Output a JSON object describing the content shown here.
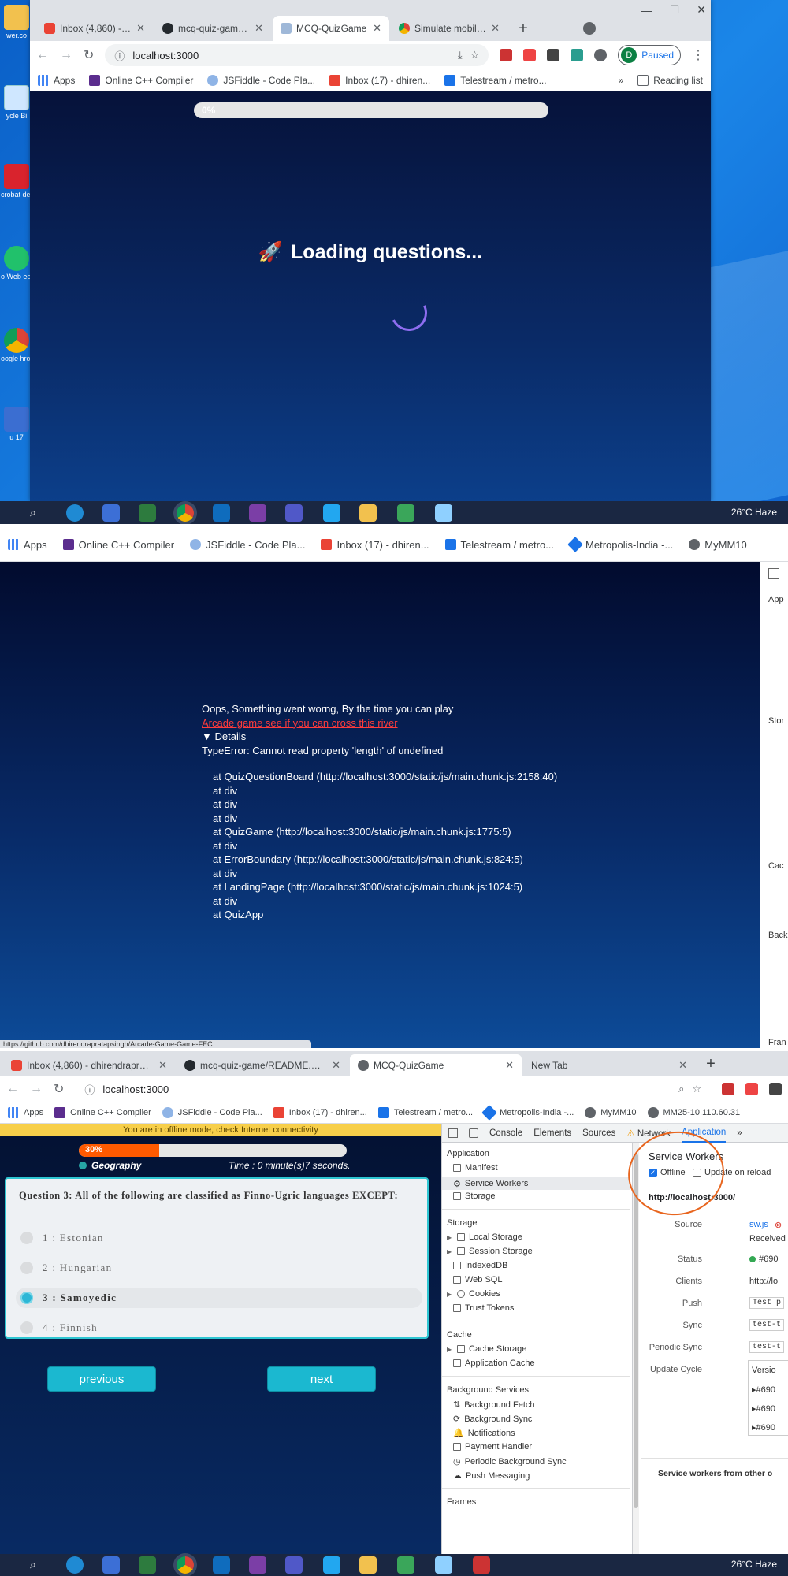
{
  "panel1": {
    "tabs": [
      {
        "title": "Inbox (4,860) - dhir"
      },
      {
        "title": "mcq-quiz-game/RE"
      },
      {
        "title": "MCQ-QuizGame"
      },
      {
        "title": "Simulate mobile d"
      }
    ],
    "address": "localhost:3000",
    "profile_status": "Paused",
    "profile_initial": "D",
    "bookmarks": [
      "Apps",
      "Online C++ Compiler",
      "JSFiddle - Code Pla...",
      "Inbox (17) - dhiren...",
      "Telestream / metro..."
    ],
    "more_bookmarks": "»",
    "reading_list": "Reading list",
    "progress_label": "0%",
    "loading_text": "Loading questions...",
    "desktop_icons": [
      "wer.co",
      "ycle Bi",
      "crobat\nder DC",
      "o Web\neetings",
      "oogle\nhrome",
      "u 17"
    ],
    "weather": "26°C  Haze"
  },
  "panel2": {
    "bookmarks": [
      "Apps",
      "Online C++ Compiler",
      "JSFiddle - Code Pla...",
      "Inbox (17) - dhiren...",
      "Telestream / metro...",
      "Metropolis-India -...",
      "MyMM10"
    ],
    "error_heading": "Oops, Something went worng, By the time you can play",
    "error_link": "Arcade game see if you can cross this river",
    "details_label": "▼ Details",
    "error_message": "TypeError: Cannot read property 'length' of undefined",
    "stack": [
      "at QuizQuestionBoard (http://localhost:3000/static/js/main.chunk.js:2158:40)",
      "at div",
      "at div",
      "at div",
      "at QuizGame (http://localhost:3000/static/js/main.chunk.js:1775:5)",
      "at div",
      "at ErrorBoundary (http://localhost:3000/static/js/main.chunk.js:824:5)",
      "at div",
      "at LandingPage (http://localhost:3000/static/js/main.chunk.js:1024:5)",
      "at div",
      "at QuizApp"
    ],
    "devtools_edge": [
      "App",
      "Stor",
      "Cac",
      "Back",
      "Fran"
    ],
    "status_url": "https://github.com/dhirendrapratapsingh/Arcade-Game-Game-FEC..."
  },
  "panel3": {
    "tabs": [
      {
        "title": "Inbox (4,860) - dhirendrapratapsi"
      },
      {
        "title": "mcq-quiz-game/README.md at"
      },
      {
        "title": "MCQ-QuizGame"
      },
      {
        "title": "New Tab"
      }
    ],
    "address": "localhost:3000",
    "bookmarks": [
      "Apps",
      "Online C++ Compiler",
      "JSFiddle - Code Pla...",
      "Inbox (17) - dhiren...",
      "Telestream / metro...",
      "Metropolis-India -...",
      "MyMM10",
      "MM25-10.110.60.31"
    ],
    "offline_notice": "You are in offline mode, check Internet connectivity",
    "progress_label": "30%",
    "progress_value": 0.3,
    "category": "Geography",
    "timer": "Time :  0 minute(s)7 seconds.",
    "question": "Question 3: All of the following are classified as Finno-Ugric languages EXCEPT:",
    "options": [
      "1 : Estonian",
      "2 : Hungarian",
      "3 : Samoyedic",
      "4 : Finnish"
    ],
    "selected_option": 2,
    "prev_label": "previous",
    "next_label": "next",
    "devtools": {
      "tabs": [
        "Console",
        "Elements",
        "Sources",
        "Network",
        "Application",
        "»"
      ],
      "sections": {
        "application": "Application",
        "app_items": [
          "Manifest",
          "Service Workers",
          "Storage"
        ],
        "storage": "Storage",
        "storage_items": [
          "Local Storage",
          "Session Storage",
          "IndexedDB",
          "Web SQL",
          "Cookies",
          "Trust Tokens"
        ],
        "cache": "Cache",
        "cache_items": [
          "Cache Storage",
          "Application Cache"
        ],
        "background": "Background Services",
        "background_items": [
          "Background Fetch",
          "Background Sync",
          "Notifications",
          "Payment Handler",
          "Periodic Background Sync",
          "Push Messaging"
        ],
        "frames": "Frames"
      },
      "main": {
        "title": "Service Workers",
        "offline_label": "Offline",
        "update_label": "Update on reload",
        "origin": "http://localhost:3000/",
        "source_label": "Source",
        "source_value": "sw.js",
        "received": "Received",
        "status_label": "Status",
        "status_value": "#690",
        "clients_label": "Clients",
        "clients_value": "http://lo",
        "push_label": "Push",
        "push_value": "Test p",
        "sync_label": "Sync",
        "sync_value": "test-t",
        "periodic_label": "Periodic Sync",
        "periodic_value": "test-t",
        "update_cycle_label": "Update Cycle",
        "version_label": "Versio",
        "versions": [
          "▸#690",
          "▸#690",
          "▸#690"
        ],
        "footer": "Service workers from other o"
      }
    },
    "weather": "26°C  Haze"
  },
  "colors": {
    "quiz_bg": "#06123a",
    "accent_cyan": "#1bb8d0",
    "progress_orange": "#ff5a00",
    "offline_yellow": "#f7cf4a",
    "annotation_orange": "#e8651e",
    "devtools_blue": "#1a73e8"
  }
}
